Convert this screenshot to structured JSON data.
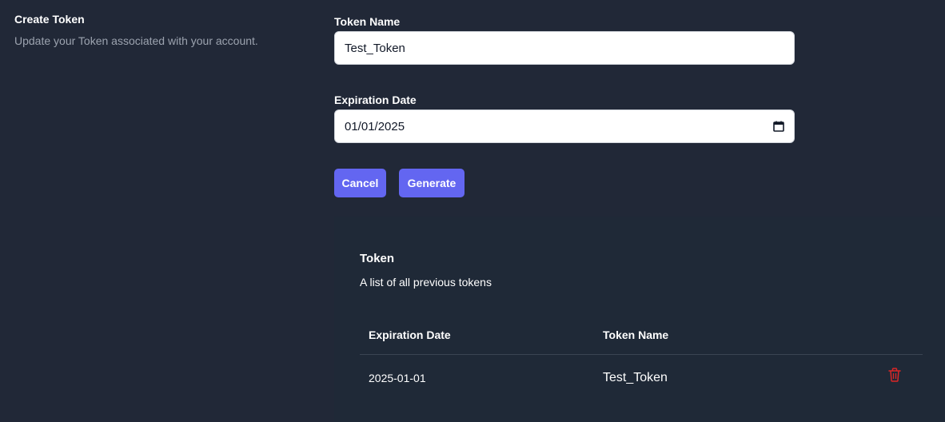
{
  "section": {
    "title": "Create Token",
    "description": "Update your Token associated with your account."
  },
  "form": {
    "token_name_label": "Token Name",
    "token_name_value": "Test_Token",
    "expiration_label": "Expiration Date",
    "expiration_value": "01/01/2025",
    "cancel_label": "Cancel",
    "generate_label": "Generate"
  },
  "token_list": {
    "title": "Token",
    "description": "A list of all previous tokens",
    "columns": [
      "Expiration Date",
      "Token Name"
    ],
    "rows": [
      {
        "expiration": "2025-01-01",
        "name": "Test_Token"
      }
    ]
  },
  "colors": {
    "background": "#212837",
    "panel": "#1f2937",
    "accent": "#6366f1",
    "delete": "#dc2626"
  },
  "icons": {
    "calendar": "calendar-icon",
    "delete": "trash-icon"
  }
}
